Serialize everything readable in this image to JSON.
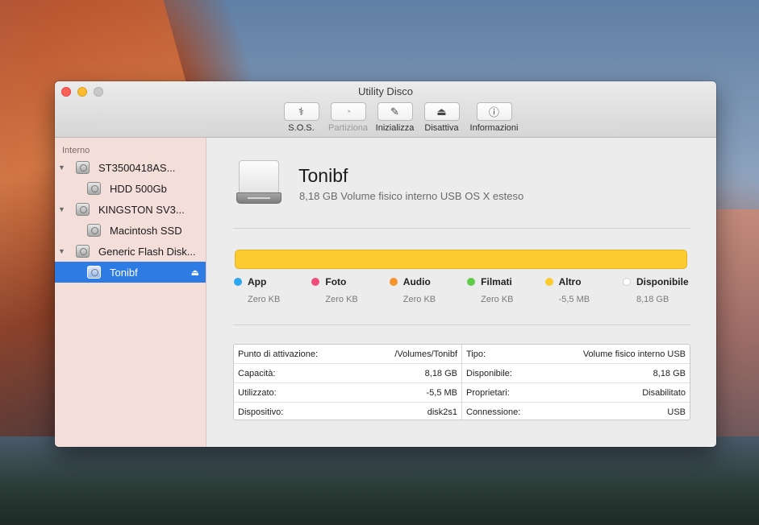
{
  "window": {
    "title": "Utility Disco"
  },
  "toolbar": [
    {
      "label": "S.O.S.",
      "icon": "stethoscope-icon",
      "glyph": "⚕",
      "enabled": true
    },
    {
      "label": "Partiziona",
      "icon": "pie-chart-icon",
      "glyph": "◔",
      "enabled": false
    },
    {
      "label": "Inizializza",
      "icon": "erase-icon",
      "glyph": "✎",
      "enabled": true
    },
    {
      "label": "Disattiva",
      "icon": "unmount-icon",
      "glyph": "⏏",
      "enabled": true
    },
    {
      "label": "Informazioni",
      "icon": "info-icon",
      "glyph": "ⓘ",
      "enabled": true
    }
  ],
  "sidebar": {
    "section": "Interno",
    "items": [
      {
        "label": "ST3500418AS...",
        "level": 0,
        "expanded": true,
        "selected": false
      },
      {
        "label": "HDD 500Gb",
        "level": 1,
        "selected": false
      },
      {
        "label": "KINGSTON SV3...",
        "level": 0,
        "expanded": true,
        "selected": false
      },
      {
        "label": "Macintosh SSD",
        "level": 1,
        "selected": false
      },
      {
        "label": "Generic Flash Disk...",
        "level": 0,
        "expanded": true,
        "selected": false
      },
      {
        "label": "Tonibf",
        "level": 1,
        "selected": true,
        "eject": "⏏"
      }
    ]
  },
  "volume": {
    "name": "Tonibf",
    "subtitle": "8,18 GB Volume fisico interno USB OS X esteso",
    "usage_color": "#fccb2f"
  },
  "legend": [
    {
      "name": "App",
      "value": "Zero KB",
      "color": "#2aa7ee"
    },
    {
      "name": "Foto",
      "value": "Zero KB",
      "color": "#f04d7a"
    },
    {
      "name": "Audio",
      "value": "Zero KB",
      "color": "#f5932c"
    },
    {
      "name": "Filmati",
      "value": "Zero KB",
      "color": "#5fcb4a"
    },
    {
      "name": "Altro",
      "value": "-5,5 MB",
      "color": "#fccb2f"
    },
    {
      "name": "Disponibile",
      "value": "8,18 GB",
      "color": "#ffffff"
    }
  ],
  "info": {
    "left": [
      {
        "label": "Punto di attivazione:",
        "value": "/Volumes/Tonibf"
      },
      {
        "label": "Capacità:",
        "value": "8,18 GB"
      },
      {
        "label": "Utilizzato:",
        "value": "-5,5 MB"
      },
      {
        "label": "Dispositivo:",
        "value": "disk2s1"
      }
    ],
    "right": [
      {
        "label": "Tipo:",
        "value": "Volume fisico interno USB"
      },
      {
        "label": "Disponibile:",
        "value": "8,18 GB"
      },
      {
        "label": "Proprietari:",
        "value": "Disabilitato"
      },
      {
        "label": "Connessione:",
        "value": "USB"
      }
    ]
  }
}
